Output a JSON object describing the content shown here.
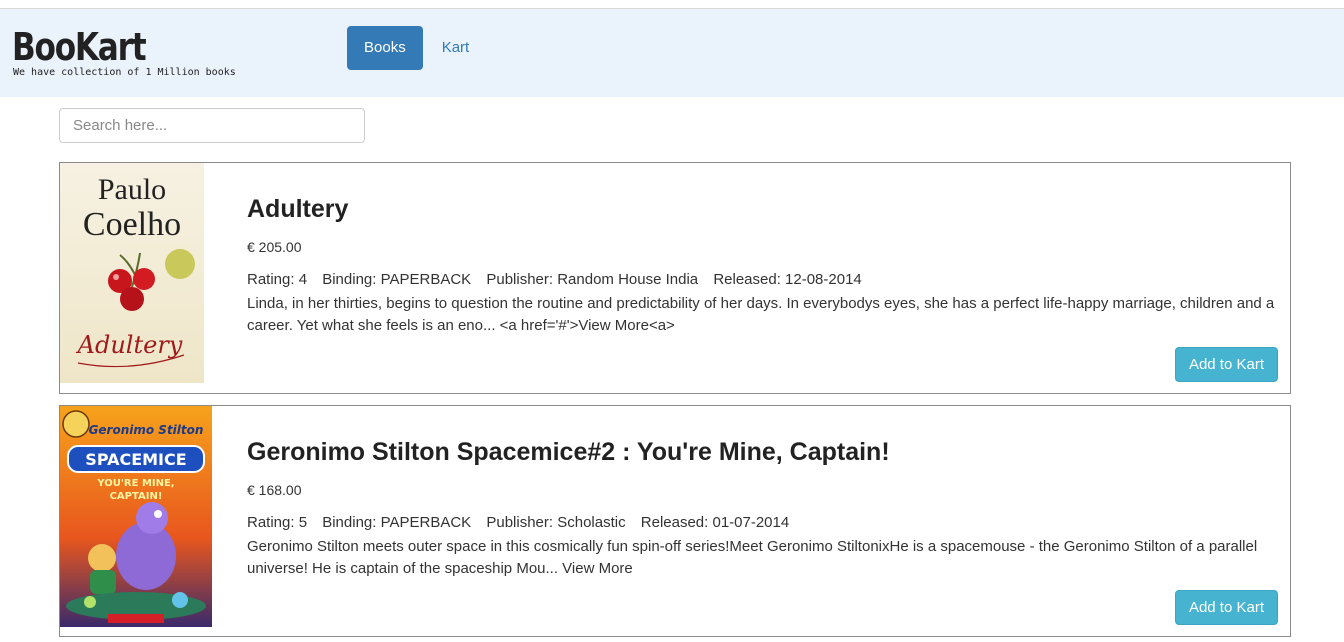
{
  "brand": {
    "title": "BooKart",
    "tagline": "We have collection of 1 Million books"
  },
  "nav": {
    "items": [
      {
        "label": "Books",
        "active": true
      },
      {
        "label": "Kart",
        "active": false
      }
    ]
  },
  "search": {
    "placeholder": "Search here...",
    "value": ""
  },
  "books": [
    {
      "title": "Adultery",
      "price": "€ 205.00",
      "rating": "Rating: 4",
      "binding": "Binding: PAPERBACK",
      "publisher": "Publisher: Random House India",
      "released": "Released: 12-08-2014",
      "description": "Linda, in her thirties, begins to question the routine and predictability of her days. In everybodys eyes, she has a perfect life-happy marriage, children and a career. Yet what she feels is an eno... <a href='#'>View More<a>",
      "add_label": "Add to Kart",
      "cover": {
        "author": "Paulo Coelho",
        "title": "Adultery"
      }
    },
    {
      "title": "Geronimo Stilton Spacemice#2 : You're Mine, Captain!",
      "price": "€ 168.00",
      "rating": "Rating: 5",
      "binding": "Binding: PAPERBACK",
      "publisher": "Publisher: Scholastic",
      "released": "Released: 01-07-2014",
      "description": "Geronimo Stilton meets outer space in this cosmically fun spin-off series!Meet Geronimo StiltonixHe is a spacemouse - the Geronimo Stilton of a parallel universe! He is captain of the spaceship Mou... View More",
      "add_label": "Add to Kart",
      "cover": {
        "author": "Geronimo Stilton",
        "series": "SPACEMICE",
        "title": "YOU'RE MINE, CAPTAIN!"
      }
    }
  ],
  "colors": {
    "header_bg": "#eaf2fb",
    "primary": "#337ab7",
    "info_button": "#46b4d0"
  }
}
